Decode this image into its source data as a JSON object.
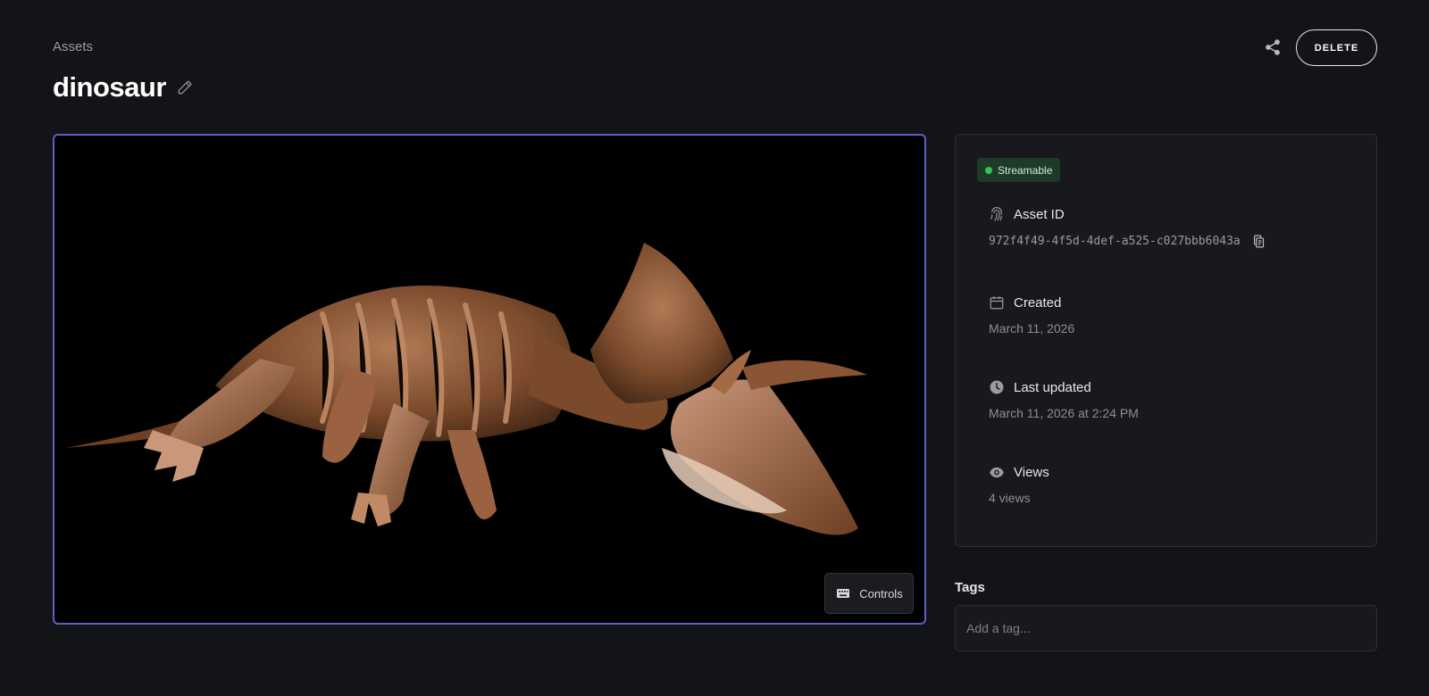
{
  "header": {
    "breadcrumb": "Assets",
    "title": "dinosaur",
    "delete_label": "DELETE"
  },
  "icons": {
    "edit": "pencil-icon",
    "share": "share-icon",
    "keyboard": "keyboard-icon",
    "fingerprint": "fingerprint-icon",
    "copy": "copy-icon",
    "calendar": "calendar-icon",
    "clock": "clock-icon",
    "eye": "eye-icon"
  },
  "viewer": {
    "controls_label": "Controls"
  },
  "info": {
    "status_badge": "Streamable",
    "asset_id_label": "Asset ID",
    "asset_id_value": "972f4f49-4f5d-4def-a525-c027bbb6043a",
    "created_label": "Created",
    "created_value": "March 11, 2026",
    "updated_label": "Last updated",
    "updated_value": "March 11, 2026 at 2:24 PM",
    "views_label": "Views",
    "views_value": "4 views"
  },
  "tags": {
    "label": "Tags",
    "placeholder": "Add a tag..."
  },
  "colors": {
    "background": "#131417",
    "card": "#18191c",
    "viewer_border": "#5b5fc7",
    "status_green": "#37c25e",
    "badge_bg": "#1f3a27"
  }
}
